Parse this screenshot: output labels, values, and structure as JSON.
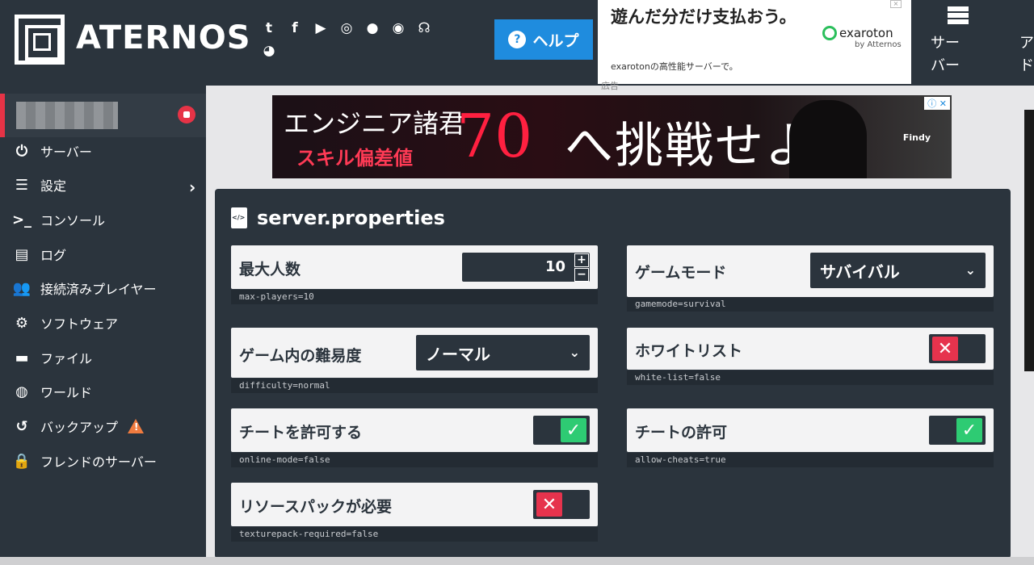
{
  "header": {
    "logo": "ATERNOS",
    "help_label": "ヘルプ",
    "ad": {
      "headline": "遊んだ分だけ支払おう。",
      "sub": "exarotonの高性能サーバーで。",
      "brand": "exaroton",
      "brand_sub": "by Atternos"
    },
    "nav_server_label": "サーバー",
    "nav_more_label": "アド"
  },
  "social_icons": [
    "twitter-icon",
    "facebook-icon",
    "youtube-icon",
    "instagram-icon",
    "reddit-icon",
    "discord-icon",
    "support-icon",
    "github-icon"
  ],
  "sidebar": {
    "items": [
      {
        "label": "サーバー",
        "icon": "power-icon"
      },
      {
        "label": "設定",
        "icon": "sliders-icon"
      },
      {
        "label": "コンソール",
        "icon": "terminal-icon"
      },
      {
        "label": "ログ",
        "icon": "document-icon"
      },
      {
        "label": "接続済みプレイヤー",
        "icon": "users-icon"
      },
      {
        "label": "ソフトウェア",
        "icon": "gears-icon"
      },
      {
        "label": "ファイル",
        "icon": "folder-icon"
      },
      {
        "label": "ワールド",
        "icon": "globe-icon"
      },
      {
        "label": "バックアップ",
        "icon": "history-icon"
      },
      {
        "label": "フレンドのサーバー",
        "icon": "user-lock-icon"
      }
    ]
  },
  "ad_label": "広告",
  "banner": {
    "line1": "エンジニア諸君",
    "line2": "スキル偏差値",
    "number": "70",
    "line3": "へ挑戦せよ",
    "brand": "Findy"
  },
  "panel": {
    "title": "server.properties",
    "props": {
      "max_players": {
        "label": "最大人数",
        "value": "10",
        "key": "max-players=10"
      },
      "gamemode": {
        "label": "ゲームモード",
        "value": "サバイバル",
        "key": "gamemode=survival"
      },
      "difficulty": {
        "label": "ゲーム内の難易度",
        "value": "ノーマル",
        "key": "difficulty=normal"
      },
      "whitelist": {
        "label": "ホワイトリスト",
        "key": "white-list=false",
        "enabled": false
      },
      "online_mode": {
        "label": "チートを許可する",
        "key": "online-mode=false",
        "enabled": true
      },
      "allow_cheats": {
        "label": "チートの許可",
        "key": "allow-cheats=true",
        "enabled": true
      },
      "texturepack": {
        "label": "リソースパックが必要",
        "key": "texturepack-required=false",
        "enabled": false
      }
    }
  },
  "colors": {
    "header_bg": "#2b343d",
    "accent_blue": "#1f8cde",
    "toggle_on": "#2ecb73",
    "toggle_off": "#e6334d",
    "status_red": "#e63346"
  }
}
